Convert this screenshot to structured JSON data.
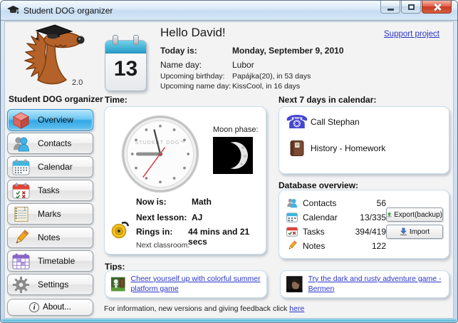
{
  "window": {
    "title": "Student DOG organizer",
    "version": "2.0",
    "controls": [
      "minimize-icon",
      "maximize-icon",
      "close-icon"
    ]
  },
  "colors": {
    "selected_button": "#35a8e6",
    "close_button": "#c63a24",
    "link": "#2a35c8",
    "calendar_header": "#2a9cc8"
  },
  "sidebar": {
    "header": "Student DOG organizer",
    "items": [
      {
        "label": "Overview",
        "icon": "cube-icon",
        "selected": true
      },
      {
        "label": "Contacts",
        "icon": "contacts-icon",
        "selected": false
      },
      {
        "label": "Calendar",
        "icon": "calendar-icon",
        "selected": false
      },
      {
        "label": "Tasks",
        "icon": "tasks-icon",
        "selected": false
      },
      {
        "label": "Marks",
        "icon": "marks-icon",
        "selected": false
      },
      {
        "label": "Notes",
        "icon": "notes-icon",
        "selected": false
      },
      {
        "label": "Timetable",
        "icon": "timetable-icon",
        "selected": false
      },
      {
        "label": "Settings",
        "icon": "gear-icon",
        "selected": false
      }
    ],
    "about_label": "About..."
  },
  "header": {
    "greeting": "Hello David!",
    "support_link": "Support project",
    "calendar_day": "13",
    "rows": [
      {
        "label": "Today is:",
        "value": "Monday, September 9, 2010"
      },
      {
        "label": "Name day:",
        "value": "Lubor"
      },
      {
        "label": "Upcoming birthday:",
        "value": "Papájka(20), in 53 days"
      },
      {
        "label": "Upcoming name day:",
        "value": "KissCool, in 16 days"
      }
    ]
  },
  "time_section": {
    "label": "Time:",
    "clock_brand": "STUDENT DOG™",
    "moon_label": "Moon phase:",
    "rows": [
      {
        "label": "Now is:",
        "value": "Math"
      },
      {
        "label": "Next lesson:",
        "value": "AJ"
      },
      {
        "label": "Rings in:",
        "value": "44 mins and 21 secs"
      },
      {
        "label": "Next classroom:",
        "value": ""
      }
    ]
  },
  "calendar_section": {
    "label": "Next 7 days in calendar:",
    "items": [
      {
        "icon": "phone-icon",
        "text": "Call Stephan"
      },
      {
        "icon": "book-icon",
        "text": "History - Homework"
      }
    ]
  },
  "database_section": {
    "label": "Database overview:",
    "rows": [
      {
        "icon": "contacts-icon",
        "label": "Contacts",
        "value": "56"
      },
      {
        "icon": "calendar-icon",
        "label": "Calendar",
        "value": "13/335"
      },
      {
        "icon": "tasks-icon",
        "label": "Tasks",
        "value": "394/419"
      },
      {
        "icon": "notes-icon",
        "label": "Notes",
        "value": "122"
      }
    ],
    "export_label": "Export(backup)",
    "import_label": "Import"
  },
  "tips": {
    "label": "Tips:",
    "items": [
      {
        "icon": "platform-game-icon",
        "text": "Cheer yourself up with colorful summer platform game"
      },
      {
        "icon": "adventure-game-icon",
        "text": "Try the dark and rusty adventure game - Bermen"
      }
    ]
  },
  "footer": {
    "text": "For information, new versions and giving feedback click",
    "link": "here"
  }
}
